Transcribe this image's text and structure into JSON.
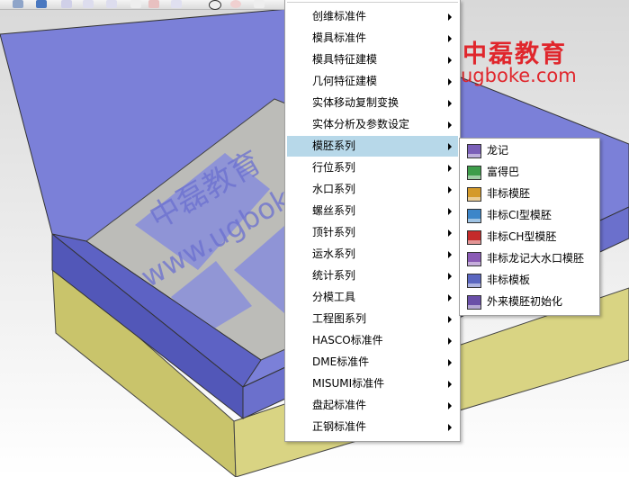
{
  "watermark": {
    "title": "中磊教育",
    "url": "ugboke.com",
    "brand_color": "#e0262c",
    "logo_icon": "green-leaf-logo-icon"
  },
  "model_overlay_text": [
    "中磊教育",
    "www.ugboke.com"
  ],
  "colors": {
    "tray_fill": "#7a7fd6",
    "tray_side": "#5a5fc2",
    "tray_floor": "#b9b9b7",
    "base_fill": "#d6d27e",
    "background": "#f0f0f0",
    "menu_highlight": "#b7d8e9"
  },
  "main_menu": {
    "items": [
      {
        "label": "创维标准件",
        "has_submenu": true
      },
      {
        "label": "模具标准件",
        "has_submenu": true
      },
      {
        "label": "模具特征建模",
        "has_submenu": true
      },
      {
        "label": "几何特征建模",
        "has_submenu": true
      },
      {
        "label": "实体移动复制变换",
        "has_submenu": true
      },
      {
        "label": "实体分析及参数设定",
        "has_submenu": true
      },
      {
        "label": "模胚系列",
        "has_submenu": true,
        "active": true
      },
      {
        "label": "行位系列",
        "has_submenu": true
      },
      {
        "label": "水口系列",
        "has_submenu": true
      },
      {
        "label": "螺丝系列",
        "has_submenu": true
      },
      {
        "label": "顶针系列",
        "has_submenu": true
      },
      {
        "label": "运水系列",
        "has_submenu": true
      },
      {
        "label": "统计系列",
        "has_submenu": true
      },
      {
        "label": "分模工具",
        "has_submenu": true
      },
      {
        "label": "工程图系列",
        "has_submenu": true
      },
      {
        "label": "HASCO标准件",
        "has_submenu": true
      },
      {
        "label": "DME标准件",
        "has_submenu": true
      },
      {
        "label": "MISUMI标准件",
        "has_submenu": true
      },
      {
        "label": "盘起标准件",
        "has_submenu": true
      },
      {
        "label": "正钢标准件",
        "has_submenu": true
      }
    ]
  },
  "sub_menu": {
    "items": [
      {
        "label": "龙记",
        "icon": "mold-base-icon",
        "color": "#7a5fb8"
      },
      {
        "label": "富得巴",
        "icon": "mold-base-green-icon",
        "color": "#3e9d4a"
      },
      {
        "label": "非标模胚",
        "icon": "mold-base-orange-icon",
        "color": "#d49a2a"
      },
      {
        "label": "非标CI型模胚",
        "icon": "mold-base-blue-icon",
        "color": "#3d86c9"
      },
      {
        "label": "非标CH型模胚",
        "icon": "mold-base-red-icon",
        "color": "#c42a2a"
      },
      {
        "label": "非标龙记大水口模胚",
        "icon": "mold-base-purple-icon",
        "color": "#8a5ab5"
      },
      {
        "label": "非标模板",
        "icon": "mold-plate-icon",
        "color": "#5a66c0"
      },
      {
        "label": "外来模胚初始化",
        "icon": "mold-init-icon",
        "color": "#6a4fa8"
      }
    ]
  }
}
